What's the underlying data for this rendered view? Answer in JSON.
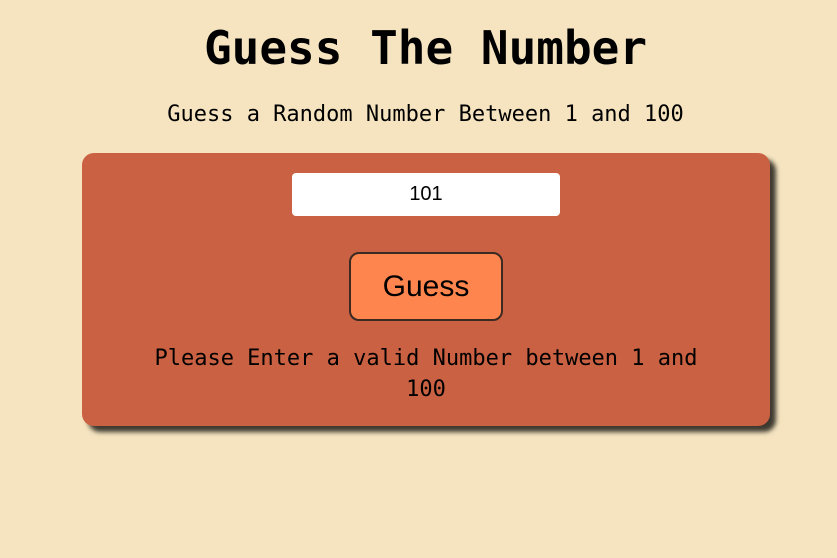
{
  "header": {
    "title": "Guess The Number",
    "subtitle": "Guess a Random Number Between 1 and 100"
  },
  "game": {
    "input_value": "101",
    "guess_button_label": "Guess",
    "message": "Please Enter a valid Number between 1 and 100"
  },
  "colors": {
    "background": "#f5e4bf",
    "card": "#ca6142",
    "button": "#ff854f",
    "input": "#ffffff"
  }
}
